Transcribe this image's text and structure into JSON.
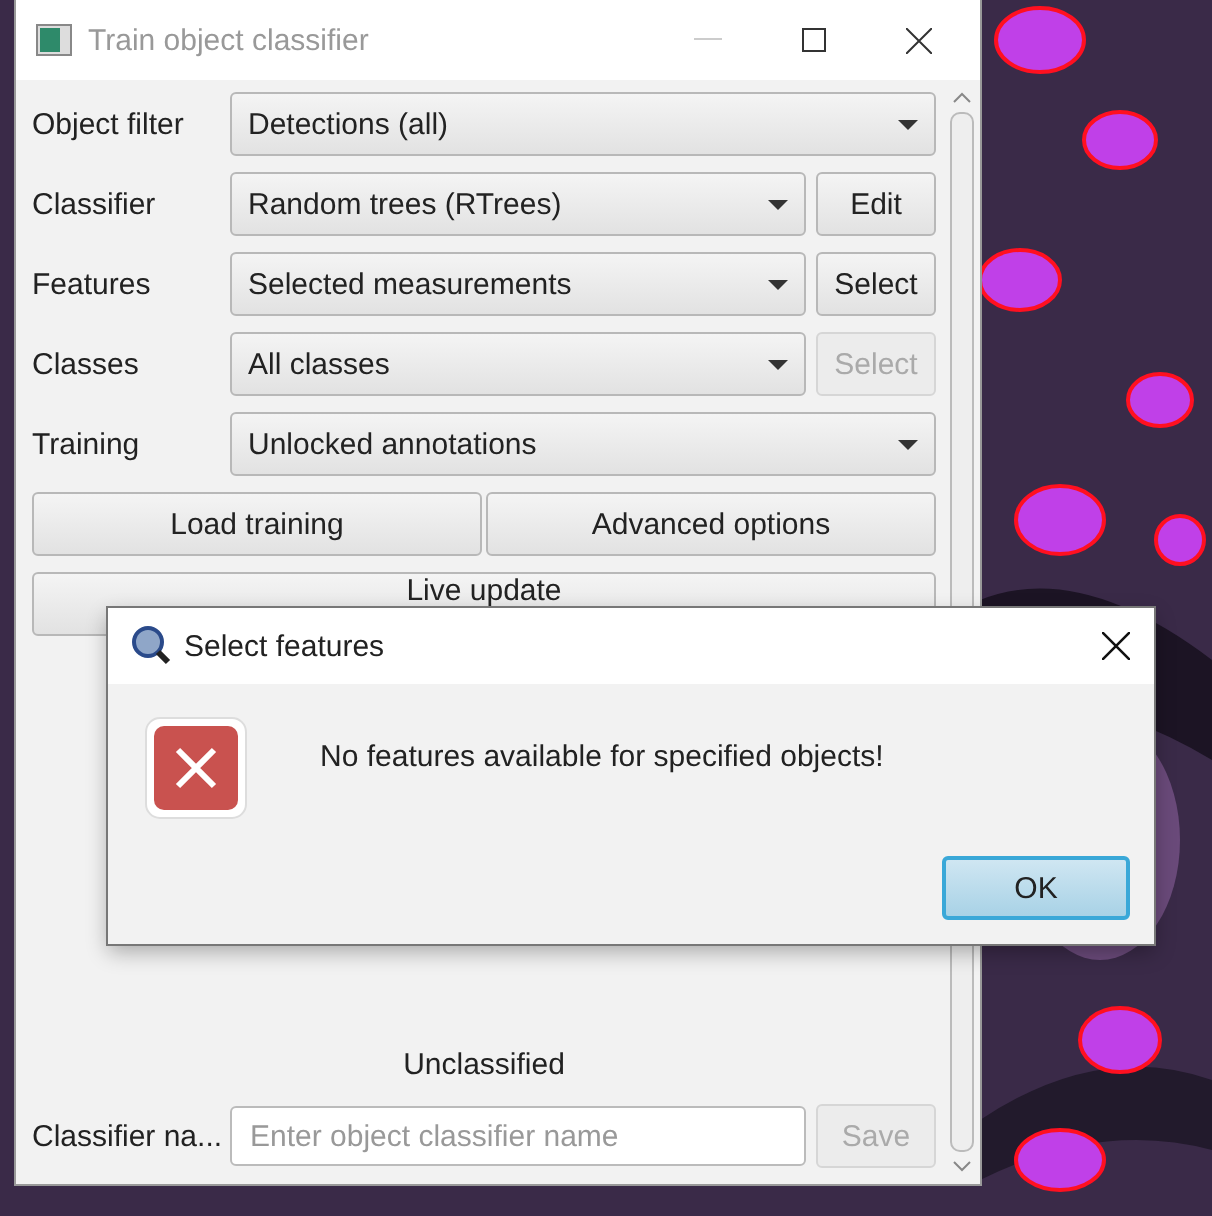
{
  "window": {
    "title": "Train object classifier"
  },
  "rows": [
    {
      "label": "Object filter",
      "value": "Detections (all)"
    },
    {
      "label": "Classifier",
      "value": "Random trees (RTrees)",
      "button": {
        "label": "Edit",
        "disabled": false
      }
    },
    {
      "label": "Features",
      "value": "Selected measurements",
      "button": {
        "label": "Select",
        "disabled": false
      }
    },
    {
      "label": "Classes",
      "value": "All classes",
      "button": {
        "label": "Select",
        "disabled": true
      }
    },
    {
      "label": "Training",
      "value": "Unlocked annotations"
    }
  ],
  "buttons": [
    "Load training",
    "Advanced options"
  ],
  "live_update": "Live update",
  "status": "Unclassified",
  "name_field": {
    "label": "Classifier na...",
    "placeholder": "Enter object classifier name"
  },
  "save_button": {
    "label": "Save",
    "disabled": true
  },
  "dialog": {
    "title": "Select features",
    "message": "No features available for specified objects!",
    "button": "OK"
  }
}
